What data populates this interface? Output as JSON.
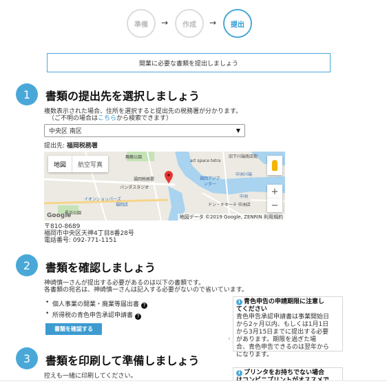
{
  "stepper": {
    "steps": [
      "準備",
      "作成",
      "提出"
    ],
    "arrow": "→",
    "active_index": 2
  },
  "banner": "開業に必要な書類を提出しましょう",
  "section1": {
    "num": "1",
    "title": "書類の提出先を選択しましょう",
    "desc1": "複数表示された場合、住所を選択すると提出先の税務署が分かります。",
    "desc2_pre": "（ご不明の場合は",
    "desc2_link": "こちら",
    "desc2_post": "から検索できます）",
    "select_value": "中央区 南区",
    "select_caret": "▼",
    "office_label": "提出先:",
    "office_name": "福岡税務署",
    "map": {
      "type_map": "地図",
      "type_satellite": "航空写真",
      "zoom_in": "+",
      "zoom_out": "−",
      "labels": [
        "舞鶴公園",
        "福岡税務署",
        "パンダスタジオ",
        "イオンショッパーズ",
        "福岡店",
        "長浜公園",
        "旧下川端商店街",
        "art space tetra",
        "福岡アジア",
        "ンター",
        "中洲川端",
        "ドン・キホーテ 中洲店",
        "中洲"
      ],
      "google": "Google",
      "footer": "地図データ ©2019 Google, ZENRIN   利用規約"
    },
    "address": {
      "zip": "〒810-8689",
      "addr": "福岡市中央区天神4丁目8番28号",
      "tel": "電話番号: 092-771-1151"
    }
  },
  "section2": {
    "num": "2",
    "title": "書類を確認しましょう",
    "desc1": "神崎慎一さんが提出する必要があるのは以下の書類です。",
    "desc2": "各書類の宛名は、神崎慎一さんは記入する必要がないので省いています。",
    "items": [
      "個人事業の開業・廃業等届出書",
      "所得税の青色申告承認申請書"
    ],
    "help_icon": "?",
    "button": "書類を確認する",
    "note": {
      "icon": "i",
      "title1": "青色申告の申請期限に注意し",
      "title2": "てください",
      "lines": [
        "青色申告承認申請書は事業開始日",
        "から2ヶ月以内、もしくは1月1日",
        "から3月15日までに提出する必要",
        "があります。期限を過ぎた場",
        "合、青色申告できるのは翌年から",
        "になります。"
      ],
      "caret": "‹"
    }
  },
  "section3": {
    "num": "3",
    "title": "書類を印刷して準備しましょう",
    "desc1": "控えも一緒に印刷してください。",
    "note": {
      "icon": "i",
      "title1": "プリンタをお持ちでない場合",
      "title2": "はコンビニプリントがオススメで"
    }
  },
  "colors": {
    "accent": "#4aa8d8",
    "button": "#3d9bd0",
    "water": "#a9d3ef",
    "park": "#c5e3b7"
  }
}
